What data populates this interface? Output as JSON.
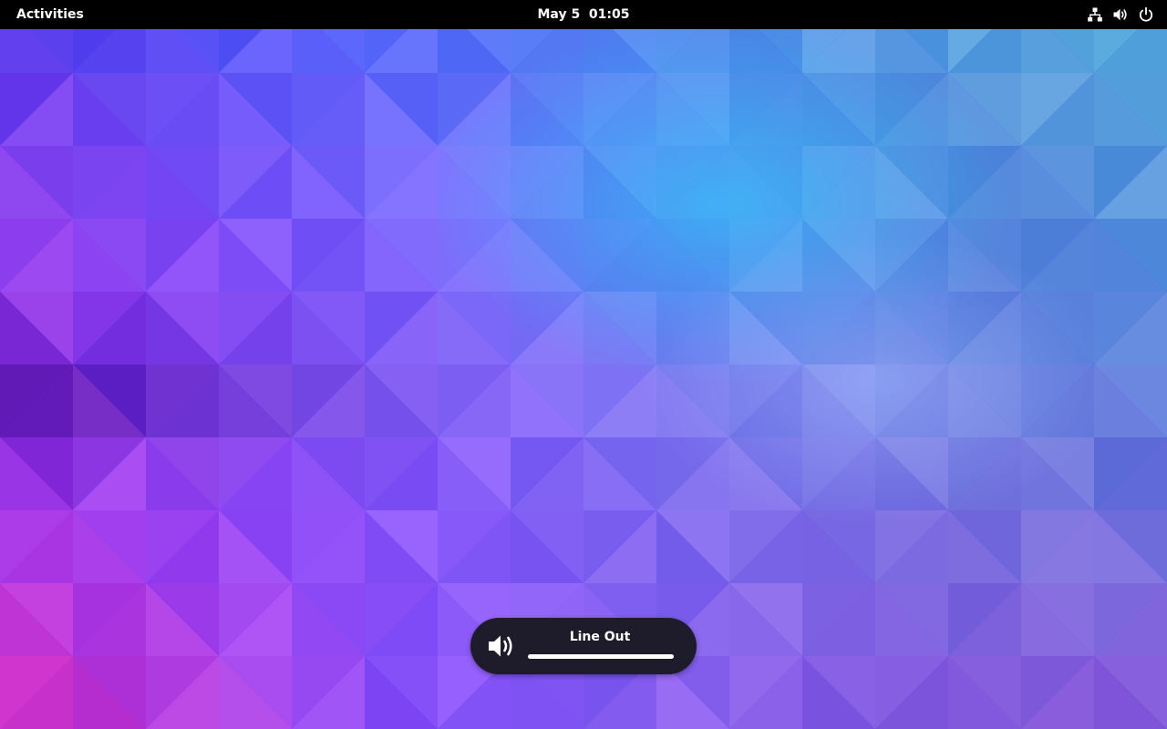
{
  "topbar": {
    "activities_label": "Activities",
    "clock": "May 5  01:05",
    "status_icons": [
      "network-wired-icon",
      "volume-high-icon",
      "power-icon"
    ]
  },
  "osd": {
    "icon": "volume-high-icon",
    "device_label": "Line Out",
    "volume_level": 1.0
  },
  "wallpaper": {
    "style": "low-poly triangles",
    "colors": [
      "#0a57ff",
      "#6a3cf5",
      "#a034c8",
      "#2fb6ff",
      "#9a80ff",
      "#1236b0"
    ]
  }
}
